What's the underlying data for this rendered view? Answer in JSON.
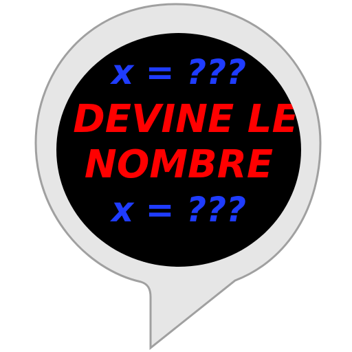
{
  "icon": {
    "shape": "speech-bubble-icon",
    "colors": {
      "bubble_fill": "#e6e6e6",
      "bubble_stroke": "#a0a0a0",
      "disc_fill": "#000000",
      "equation_text": "#1f3cff",
      "title_text": "#ff0000"
    },
    "lines": {
      "top_equation": "x = ???",
      "title_line1": "DEVINE LE",
      "title_line2": "NOMBRE",
      "bottom_equation": "x = ???"
    }
  }
}
